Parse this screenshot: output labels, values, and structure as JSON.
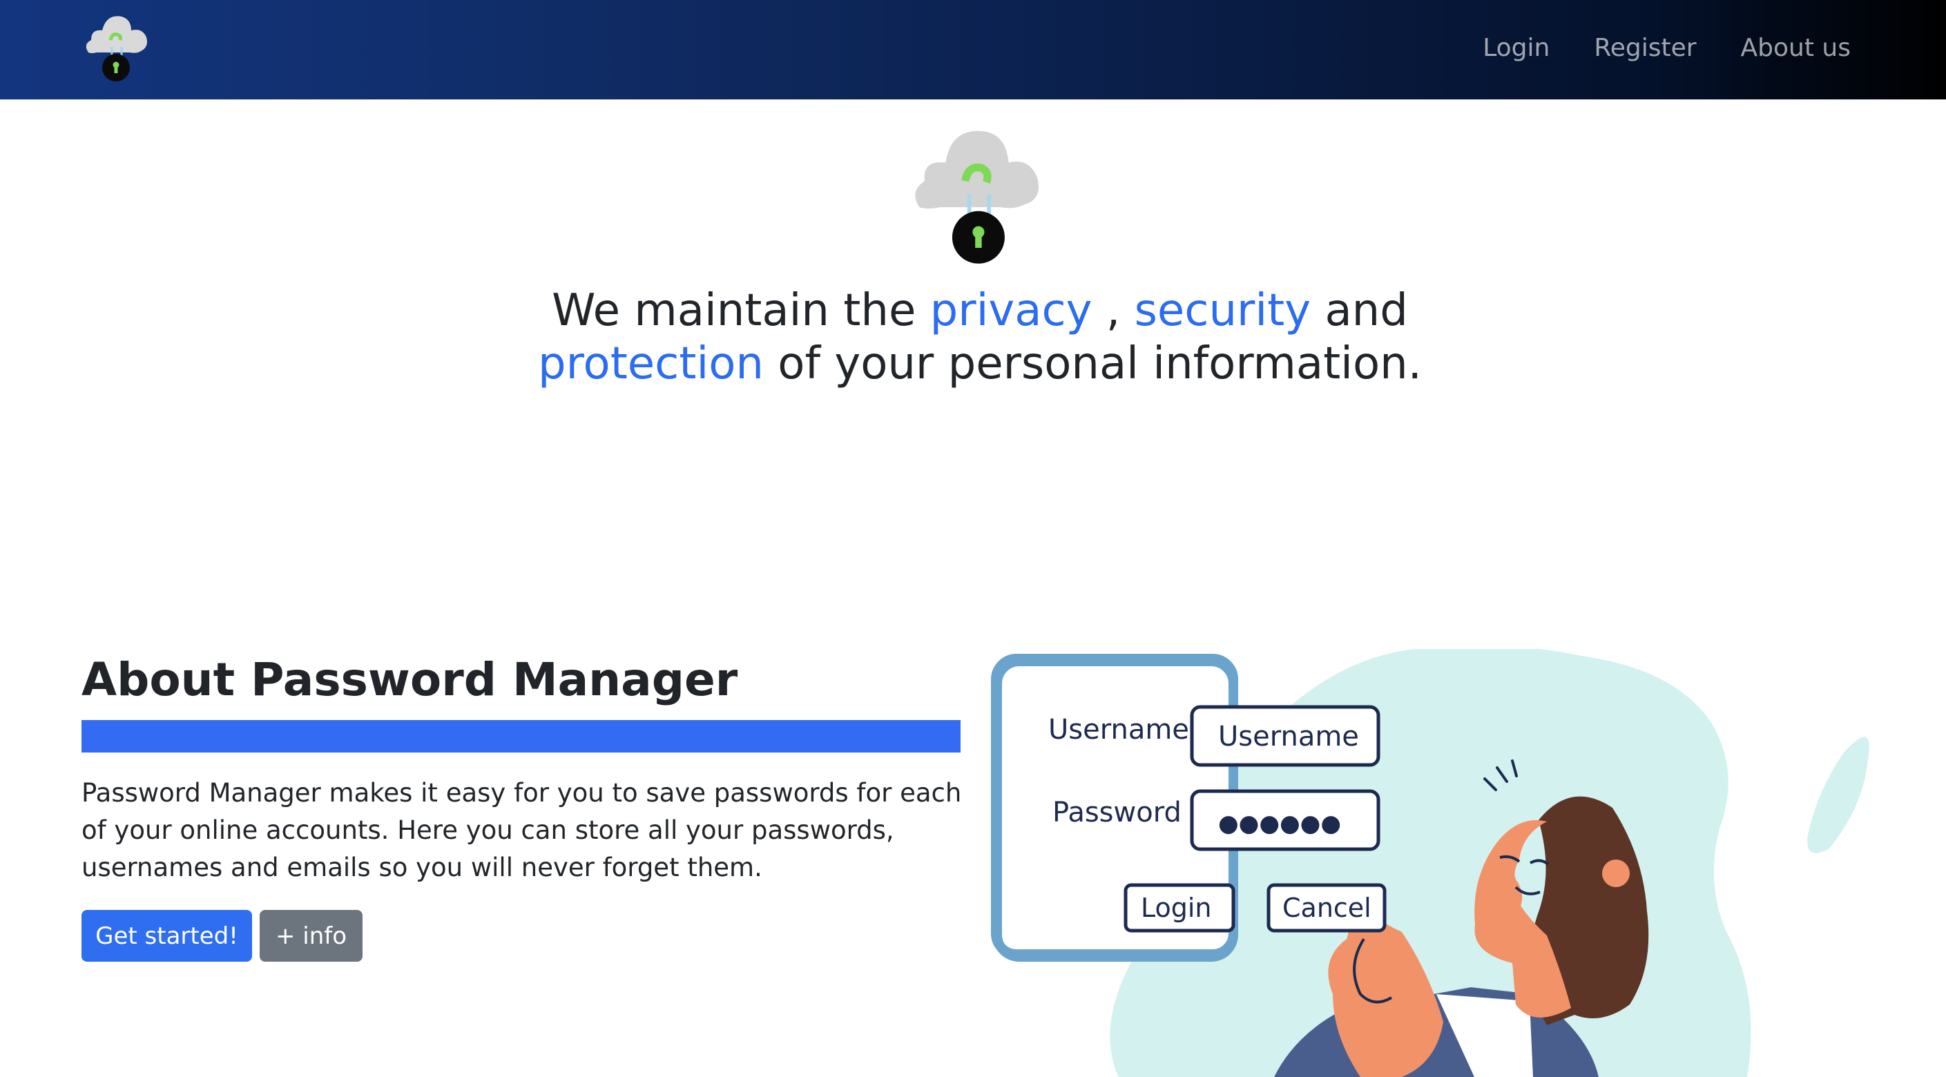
{
  "nav": {
    "logo_icon": "cloud-lock-icon",
    "links": [
      "Login",
      "Register",
      "About us"
    ]
  },
  "hero": {
    "logo_icon": "cloud-lock-icon",
    "tagline": {
      "t1": "We maintain the ",
      "w1": "privacy",
      "t2": " , ",
      "w2": "security",
      "t3": " and ",
      "w3": "protection",
      "t4": " of your personal information."
    }
  },
  "about": {
    "title": "About Password Manager",
    "text": "Password Manager makes it easy for you to save passwords for each of your online accounts. Here you can store all your passwords, usernames and emails so you will never forget them.",
    "buttons": {
      "get_started": "Get started!",
      "info": "+ info"
    }
  },
  "illustration": {
    "icon": "login-form-illustration",
    "username_label": "Username",
    "username_value": "Username",
    "password_label": "Password",
    "password_value": "●●●●●●",
    "login": "Login",
    "cancel": "Cancel"
  },
  "colors": {
    "accent": "#2b6cf0",
    "navbar_start": "#13357f",
    "navbar_end": "#000000",
    "secondary_button": "#6c757d",
    "logo_green": "#7ed957"
  }
}
